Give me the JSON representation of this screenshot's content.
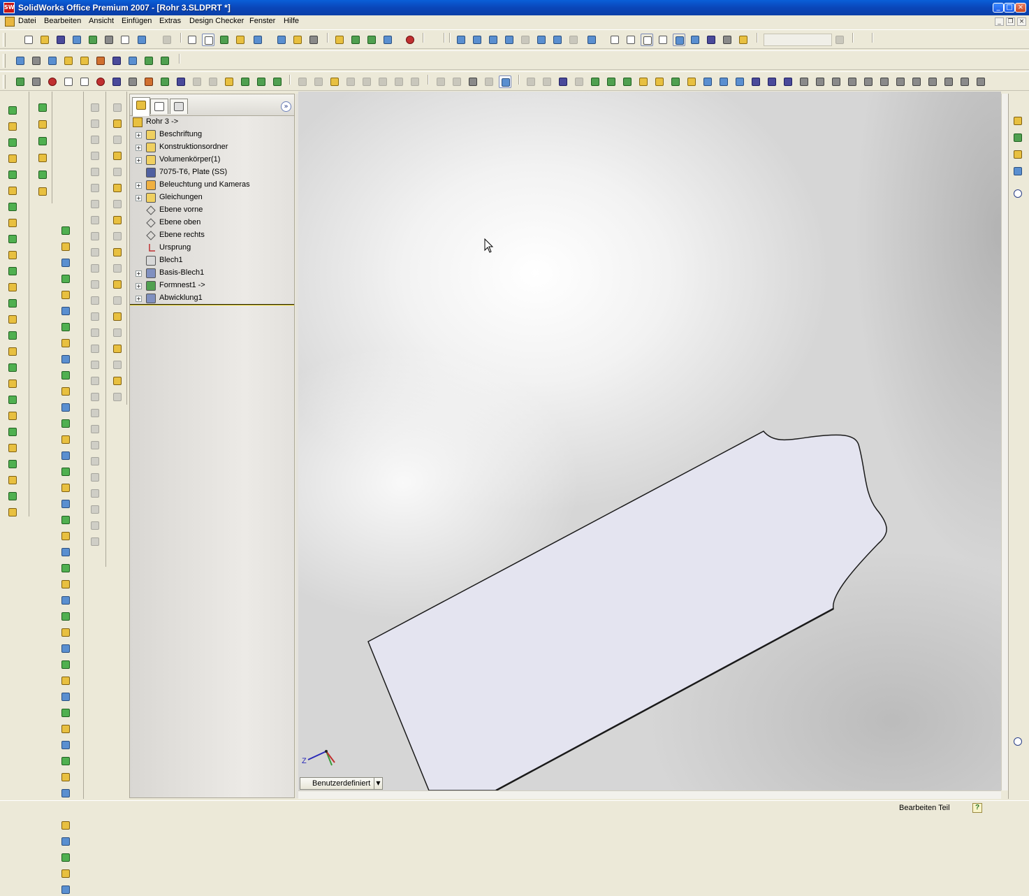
{
  "window": {
    "title": "SolidWorks Office Premium 2007 - [Rohr 3.SLDPRT *]",
    "app_icon": "SW",
    "controls": [
      "minimize",
      "maximize",
      "close"
    ]
  },
  "menu": {
    "items": [
      "Datei",
      "Bearbeiten",
      "Ansicht",
      "Einfügen",
      "Extras",
      "Design Checker",
      "Fenster",
      "Hilfe"
    ]
  },
  "feature_manager": {
    "tabs": [
      "featuremanager-tree",
      "property-manager",
      "configuration-manager"
    ],
    "root": "Rohr 3 ->",
    "items": [
      {
        "label": "Beschriftung",
        "icon": "annotations-icon",
        "expandable": true
      },
      {
        "label": "Konstruktionsordner",
        "icon": "design-binder-icon",
        "expandable": true
      },
      {
        "label": "Volumenkörper(1)",
        "icon": "solid-bodies-icon",
        "expandable": true
      },
      {
        "label": "7075-T6, Plate (SS)",
        "icon": "material-icon",
        "expandable": false
      },
      {
        "label": "Beleuchtung und Kameras",
        "icon": "lights-cameras-icon",
        "expandable": true
      },
      {
        "label": "Gleichungen",
        "icon": "equations-icon",
        "expandable": true
      },
      {
        "label": "Ebene vorne",
        "icon": "plane-icon",
        "expandable": false
      },
      {
        "label": "Ebene oben",
        "icon": "plane-icon",
        "expandable": false
      },
      {
        "label": "Ebene rechts",
        "icon": "plane-icon",
        "expandable": false
      },
      {
        "label": "Ursprung",
        "icon": "origin-icon",
        "expandable": false
      },
      {
        "label": "Blech1",
        "icon": "sheet-metal-icon",
        "expandable": false
      },
      {
        "label": "Basis-Blech1",
        "icon": "base-flange-icon",
        "expandable": true
      },
      {
        "label": "Formnest1 ->",
        "icon": "cavity-icon",
        "expandable": true
      },
      {
        "label": "Abwicklung1",
        "icon": "flat-pattern-icon",
        "expandable": true
      }
    ]
  },
  "viewport": {
    "view_orientation": "Benutzerdefiniert",
    "triad_label": "Z",
    "part_fill": "#e4e4f0",
    "part_edge": "#1a1a1a"
  },
  "status": {
    "mode": "Bearbeiten Teil",
    "help_icon": "?"
  }
}
